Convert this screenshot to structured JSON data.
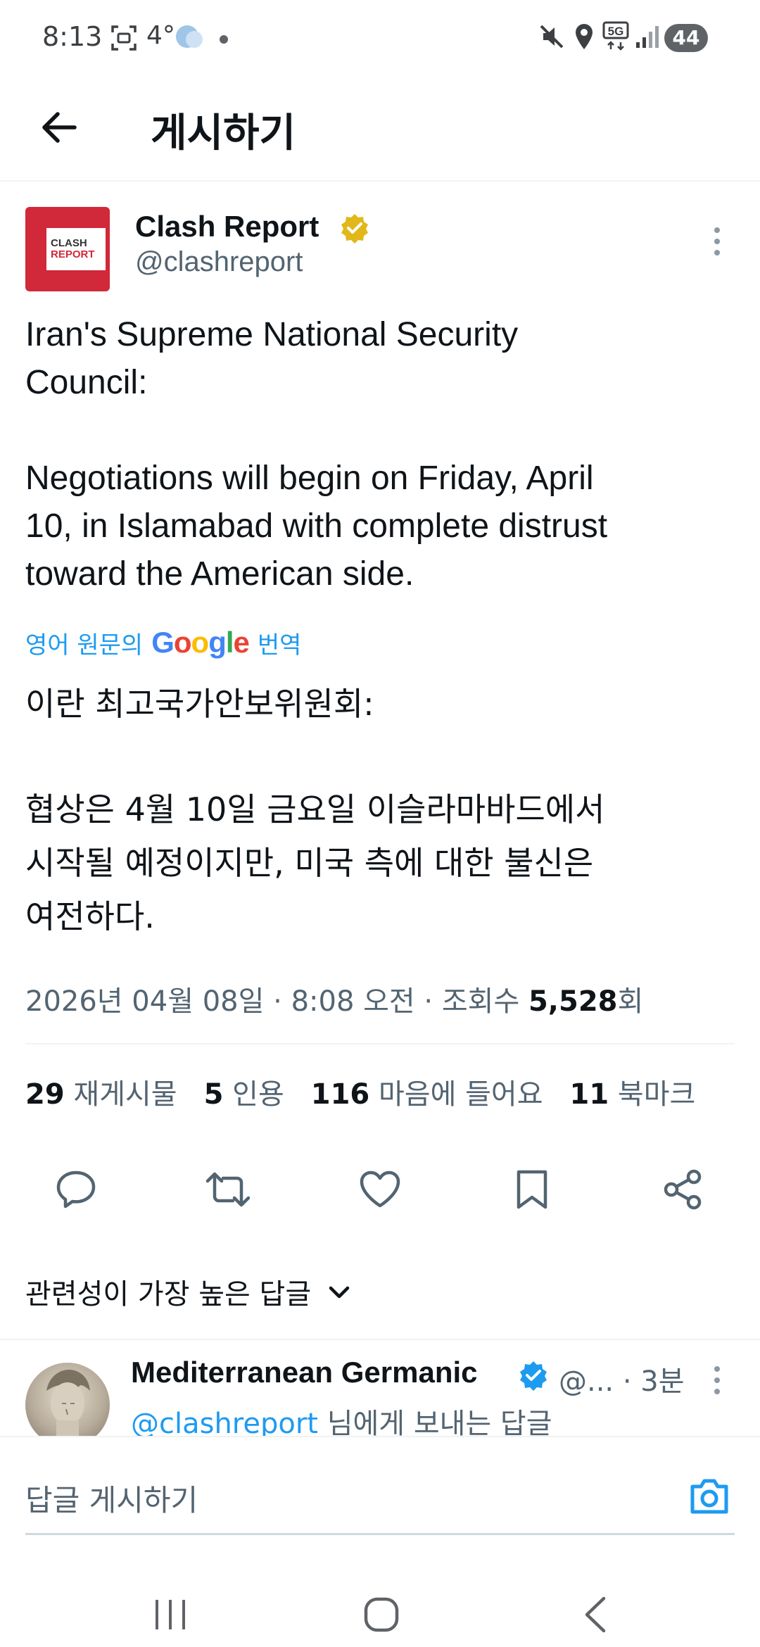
{
  "status_bar": {
    "time": "8:13",
    "temperature": "4°",
    "battery": "44"
  },
  "header": {
    "title": "게시하기"
  },
  "tweet": {
    "author_name": "Clash Report",
    "author_handle": "@clashreport",
    "avatar_logo_line1": "CLASH",
    "avatar_logo_line2": "REPORT",
    "text_line1": "Iran's Supreme National Security",
    "text_line2": "Council:",
    "text_line3": "Negotiations will begin on Friday, April",
    "text_line4": "10, in Islamabad with complete distrust",
    "text_line5": "toward the American side.",
    "translate_prefix": "영어 원문의",
    "translate_brand": "Google",
    "translate_suffix": "번역",
    "translated_line1": "이란 최고국가안보위원회:",
    "translated_line2": "협상은 4월 10일 금요일 이슬라마바드에서",
    "translated_line3": "시작될 예정이지만, 미국 측에 대한 불신은",
    "translated_line4": "여전하다.",
    "timestamp": "2026년 04월 08일 · 8:08 오전 · 조회수 ",
    "views": "5,528",
    "views_suffix": "회"
  },
  "stats": {
    "reposts_count": "29",
    "reposts_label": "재게시물",
    "quotes_count": "5",
    "quotes_label": "인용",
    "likes_count": "116",
    "likes_label": "마음에 들어요",
    "bookmarks_count": "11",
    "bookmarks_label": "북마크"
  },
  "replies": {
    "sort_label": "관련성이 가장 높은 답글",
    "first_reply": {
      "name": "Mediterranean Germanic",
      "handle_time": "@... · 3분",
      "replying_mention": "@clashreport",
      "replying_suffix": " 님에게 보내는 답글"
    }
  },
  "composer": {
    "placeholder": "답글 게시하기"
  },
  "colors": {
    "accent": "#1d9bf0",
    "secondary_text": "#536471",
    "brand_red": "#d1283a",
    "gold_badge": "#e2b719"
  },
  "icons": [
    "back-arrow-icon",
    "gold-verified-icon",
    "more-vert-icon",
    "reply-icon",
    "repost-icon",
    "like-icon",
    "bookmark-icon",
    "share-icon",
    "chevron-down-icon",
    "blue-verified-icon",
    "camera-icon",
    "recent-apps-icon",
    "home-icon",
    "nav-back-icon"
  ]
}
